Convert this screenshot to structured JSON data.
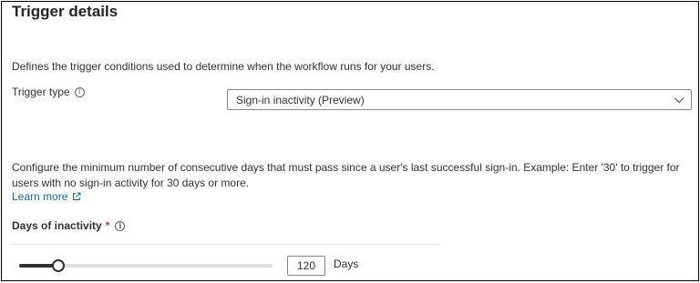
{
  "header": {
    "title": "Trigger details"
  },
  "description": "Defines the trigger conditions used to determine when the workflow runs for your users.",
  "trigger_type": {
    "label": "Trigger type",
    "info_icon": "info-icon",
    "selected": "Sign-in inactivity (Preview)",
    "chevron_icon": "chevron-down-icon"
  },
  "config": {
    "text": "Configure the minimum number of consecutive days that must pass since a user's last successful sign-in. Example: Enter '30' to trigger for users with no sign-in activity for 30 days or more.",
    "learn_more": "Learn more",
    "learn_more_icon": "external-link-icon"
  },
  "inactivity": {
    "label": "Days of inactivity",
    "required_marker": "*",
    "info_icon": "info-icon",
    "value": "120",
    "unit": "Days",
    "slider_fraction": 0.13
  },
  "colors": {
    "link": "#0f6cbd",
    "required": "#c4314b",
    "text": "#323130"
  }
}
